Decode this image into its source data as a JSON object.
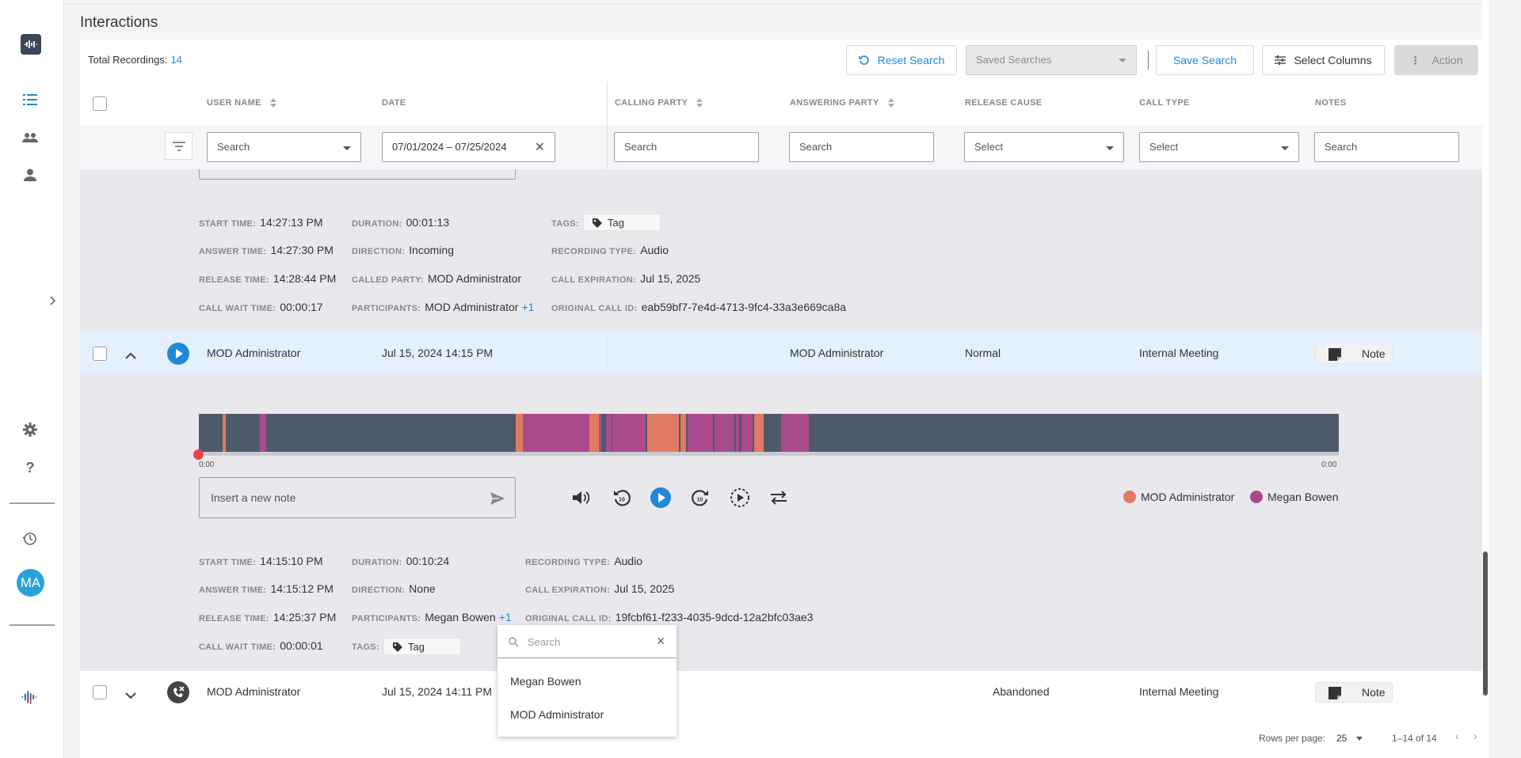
{
  "page_title": "Interactions",
  "summary": {
    "label": "Total Recordings:",
    "count": "14"
  },
  "toolbar": {
    "reset_label": "Reset Search",
    "saved_searches_placeholder": "Saved Searches",
    "save_label": "Save Search",
    "columns_label": "Select Columns",
    "action_label": "Action"
  },
  "columns": {
    "user_name": "USER NAME",
    "date": "DATE",
    "calling_party": "CALLING PARTY",
    "answering_party": "ANSWERING PARTY",
    "release_cause": "RELEASE CAUSE",
    "call_type": "CALL TYPE",
    "notes": "NOTES"
  },
  "filters": {
    "user_name": "Search",
    "date": "07/01/2024 – 07/25/2024",
    "calling_party": "Search",
    "answering_party": "Search",
    "release_cause": "Select",
    "call_type": "Select",
    "notes": "Search"
  },
  "labels": {
    "start_time": "START TIME:",
    "answer_time": "ANSWER TIME:",
    "release_time": "RELEASE TIME:",
    "call_wait_time": "CALL WAIT TIME:",
    "duration": "DURATION:",
    "direction": "DIRECTION:",
    "called_party": "CALLED PARTY:",
    "participants": "PARTICIPANTS:",
    "tags": "TAGS:",
    "recording_type": "RECORDING TYPE:",
    "call_expiration": "CALL EXPIRATION:",
    "original_call_id": "ORIGINAL CALL ID:"
  },
  "prev_details": {
    "start_time": "14:27:13 PM",
    "answer_time": "14:27:30 PM",
    "release_time": "14:28:44 PM",
    "call_wait_time": "00:00:17",
    "duration": "00:01:13",
    "direction": "Incoming",
    "called_party": "MOD Administrator",
    "participants": "MOD Administrator",
    "participants_more": "+1",
    "tag": "Tag",
    "recording_type": "Audio",
    "call_expiration": "Jul 15, 2025",
    "original_call_id": "eab59bf7-7e4d-4713-9fc4-33a3e669ca8a"
  },
  "rows": [
    {
      "user": "MOD Administrator",
      "date": "Jul 15, 2024 14:15 PM",
      "answering_party": "MOD Administrator",
      "release_cause": "Normal",
      "call_type": "Internal Meeting",
      "note": "Note"
    },
    {
      "user": "MOD Administrator",
      "date": "Jul 15, 2024 14:11 PM",
      "release_cause": "Abandoned",
      "call_type": "Internal Meeting",
      "note": "Note"
    }
  ],
  "player": {
    "time_start": "0:00",
    "time_end": "0:00",
    "note_placeholder": "Insert a new note",
    "legend": [
      {
        "name": "MOD Administrator",
        "color": "#e07a62"
      },
      {
        "name": "Megan Bowen",
        "color": "#a84a8c"
      }
    ],
    "track_color": "#4e5a6a"
  },
  "expanded_details": {
    "start_time": "14:15:10 PM",
    "answer_time": "14:15:12 PM",
    "release_time": "14:25:37 PM",
    "call_wait_time": "00:00:01",
    "duration": "00:10:24",
    "direction": "None",
    "participants": "Megan Bowen",
    "participants_more": "+1",
    "tag": "Tag",
    "recording_type": "Audio",
    "call_expiration": "Jul 15, 2025",
    "original_call_id": "19fcbf61-f233-4035-9dcd-12a2bfc03ae3"
  },
  "participants_popup": {
    "search_placeholder": "Search",
    "items": [
      "Megan Bowen",
      "MOD Administrator"
    ]
  },
  "footer": {
    "rows_per_page_label": "Rows per page:",
    "rows_per_page": "25",
    "range": "1–14 of 14"
  },
  "sidebar": {
    "avatar_initials": "MA"
  },
  "colors": {
    "accent": "#1f88d8",
    "selected_row": "#e4f1fc",
    "expanded_bg": "#e9e9ed"
  }
}
